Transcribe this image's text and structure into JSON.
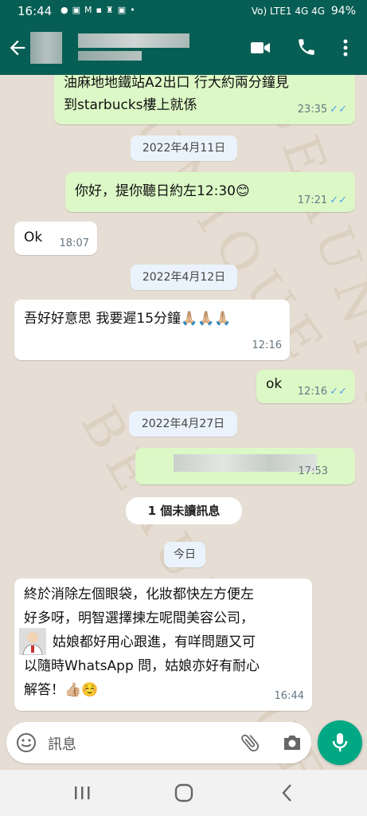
{
  "status_bar": {
    "time": "16:44",
    "network": "Vo) LTE1 4G 4G",
    "battery": "94%"
  },
  "header": {
    "back_icon": "arrow-left-icon",
    "contact_name": "",
    "icons": [
      "video-call-icon",
      "phone-icon",
      "more-vert-icon"
    ]
  },
  "messages": [
    {
      "type": "out",
      "text_line1": "油麻地地鐵站A2出口 行大約兩分鐘見",
      "text_line2": "到starbucks樓上就係",
      "time": "23:35"
    },
    {
      "type": "date",
      "text": "2022年4月11日"
    },
    {
      "type": "out",
      "text": "你好，提你聽日約左12:30😊",
      "time": "17:21"
    },
    {
      "type": "in",
      "text": "Ok",
      "time": "18:07"
    },
    {
      "type": "date",
      "text": "2022年4月12日"
    },
    {
      "type": "in",
      "text": "吾好好意思 我要遲15分鐘🙏🏼🙏🏼🙏🏼",
      "time": "12:16"
    },
    {
      "type": "out",
      "text": "ok",
      "time": "12:16"
    },
    {
      "type": "date",
      "text": "2022年4月27日"
    },
    {
      "type": "out-blurred",
      "text": "",
      "time": "17:53"
    },
    {
      "type": "unread",
      "text": "1 個未讀訊息"
    },
    {
      "type": "date",
      "text": "今日"
    },
    {
      "type": "in-long",
      "line1": "終於消除左個眼袋，化妝都快左方便左",
      "line2": "好多呀，明智選擇揀左呢間美容公司，",
      "line3": "姑娘都好用心跟進，有咩問題又可",
      "line4": "以隨時WhatsApp 問，姑娘亦好有耐心",
      "line5": "解答！👍🏼☺️",
      "time": "16:44"
    }
  ],
  "input": {
    "placeholder": "訊息",
    "emoji_icon": "emoji-icon",
    "attach_icon": "paperclip-icon",
    "camera_icon": "camera-icon",
    "mic_icon": "mic-icon"
  },
  "watermark": "BEAUNIQUE",
  "colors": {
    "header": "#075e54",
    "outgoing_bubble": "#dcf8c6",
    "incoming_bubble": "#ffffff",
    "read_ticks": "#4fa3e8",
    "mic_button": "#00a884"
  }
}
